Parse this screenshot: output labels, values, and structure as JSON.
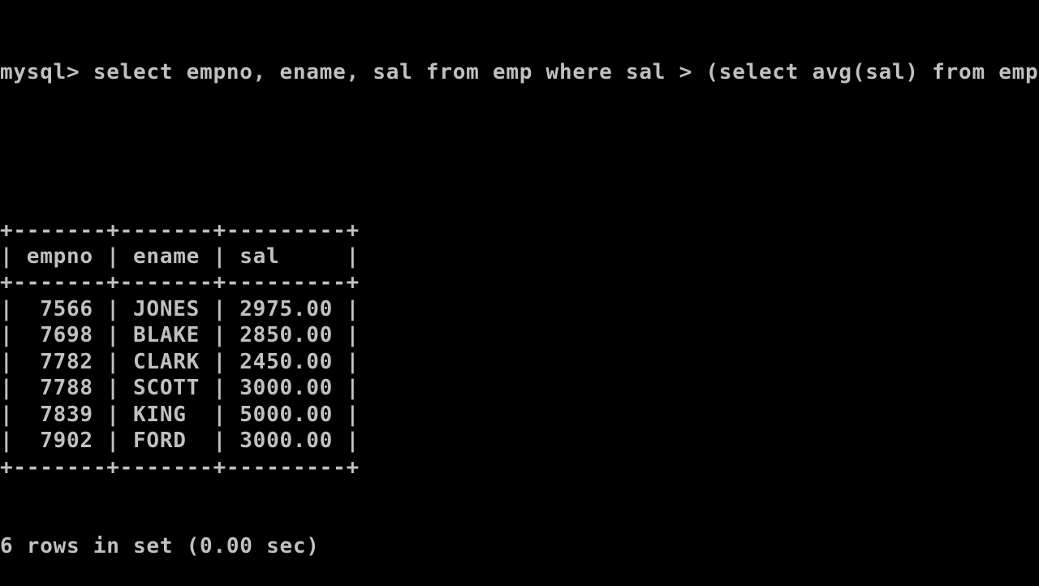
{
  "terminal": {
    "prompt": "mysql> ",
    "command": "select empno, ename, sal from emp where sal > (select avg(sal) from emp);",
    "table": {
      "border": "+-------+-------+---------+",
      "columns": [
        "empno",
        "ename",
        "sal"
      ],
      "rows": [
        [
          "7566",
          "JONES",
          "2975.00"
        ],
        [
          "7698",
          "BLAKE",
          "2850.00"
        ],
        [
          "7782",
          "CLARK",
          "2450.00"
        ],
        [
          "7788",
          "SCOTT",
          "3000.00"
        ],
        [
          "7839",
          "KING",
          "5000.00"
        ],
        [
          "7902",
          "FORD",
          "3000.00"
        ]
      ]
    },
    "result_summary": "6 rows in set (0.00 sec)"
  },
  "colors": {
    "background": "#000000",
    "text": "#c0c0c0"
  }
}
